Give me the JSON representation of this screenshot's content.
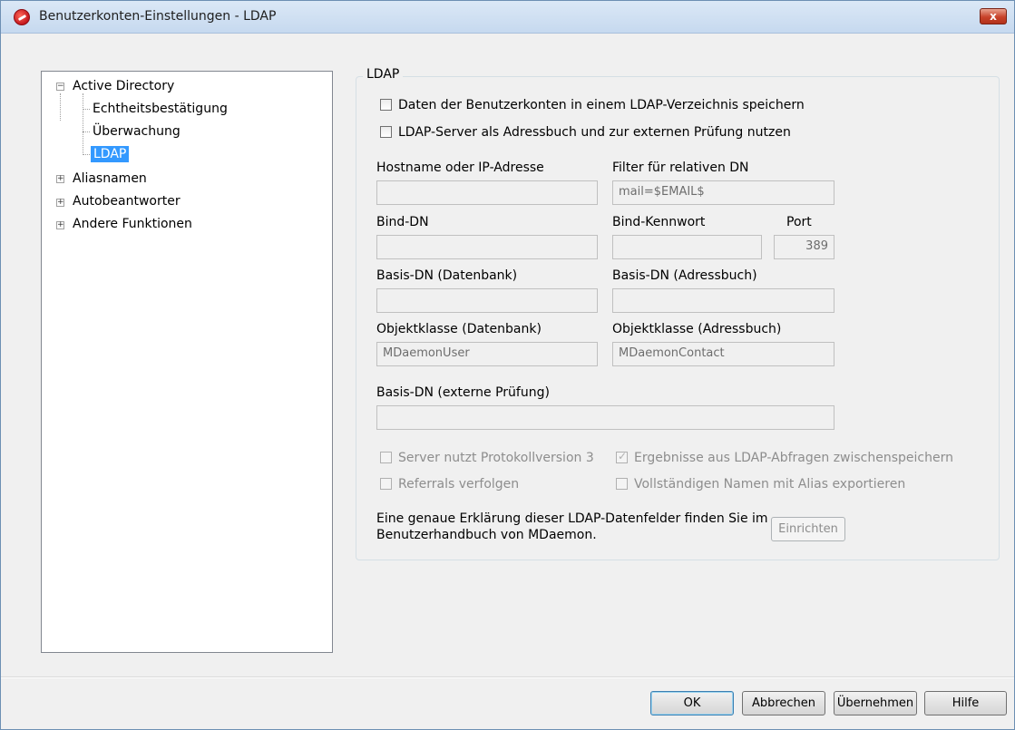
{
  "window": {
    "title": "Benutzerkonten-Einstellungen - LDAP",
    "close_label": "x"
  },
  "tree": {
    "items": [
      {
        "label": "Active Directory",
        "expander": "−"
      },
      {
        "label": "Echtheitsbestätigung"
      },
      {
        "label": "Überwachung"
      },
      {
        "label": "LDAP",
        "selected": true
      },
      {
        "label": "Aliasnamen",
        "expander": "+"
      },
      {
        "label": "Autobeantworter",
        "expander": "+"
      },
      {
        "label": "Andere Funktionen",
        "expander": "+"
      }
    ]
  },
  "ldap": {
    "group_title": "LDAP",
    "store_accounts_label": "Daten der Benutzerkonten in einem LDAP-Verzeichnis speichern",
    "use_addressbook_label": "LDAP-Server als Adressbuch und zur externen Prüfung nutzen",
    "hostname_label": "Hostname oder IP-Adresse",
    "hostname_value": "",
    "rdn_filter_label": "Filter für relativen DN",
    "rdn_filter_value": "mail=$EMAIL$",
    "bind_dn_label": "Bind-DN",
    "bind_dn_value": "",
    "bind_password_label": "Bind-Kennwort",
    "bind_password_value": "",
    "port_label": "Port",
    "port_value": "389",
    "base_dn_db_label": "Basis-DN (Datenbank)",
    "base_dn_db_value": "",
    "base_dn_ab_label": "Basis-DN (Adressbuch)",
    "base_dn_ab_value": "",
    "objclass_db_label": "Objektklasse (Datenbank)",
    "objclass_db_value": "MDaemonUser",
    "objclass_ab_label": "Objektklasse (Adressbuch)",
    "objclass_ab_value": "MDaemonContact",
    "base_dn_ext_label": "Basis-DN (externe Prüfung)",
    "base_dn_ext_value": "",
    "protocol_v3_label": "Server nutzt Protokollversion 3",
    "cache_results_label": "Ergebnisse aus LDAP-Abfragen zwischenspeichern",
    "referrals_label": "Referrals verfolgen",
    "export_alias_label": "Vollständigen Namen mit Alias exportieren",
    "info_text_line1": "Eine genaue Erklärung dieser LDAP-Datenfelder finden Sie im",
    "info_text_line2": "Benutzerhandbuch von MDaemon.",
    "setup_button": "Einrichten"
  },
  "footer": {
    "ok": "OK",
    "cancel": "Abbrechen",
    "apply": "Übernehmen",
    "help": "Hilfe"
  }
}
